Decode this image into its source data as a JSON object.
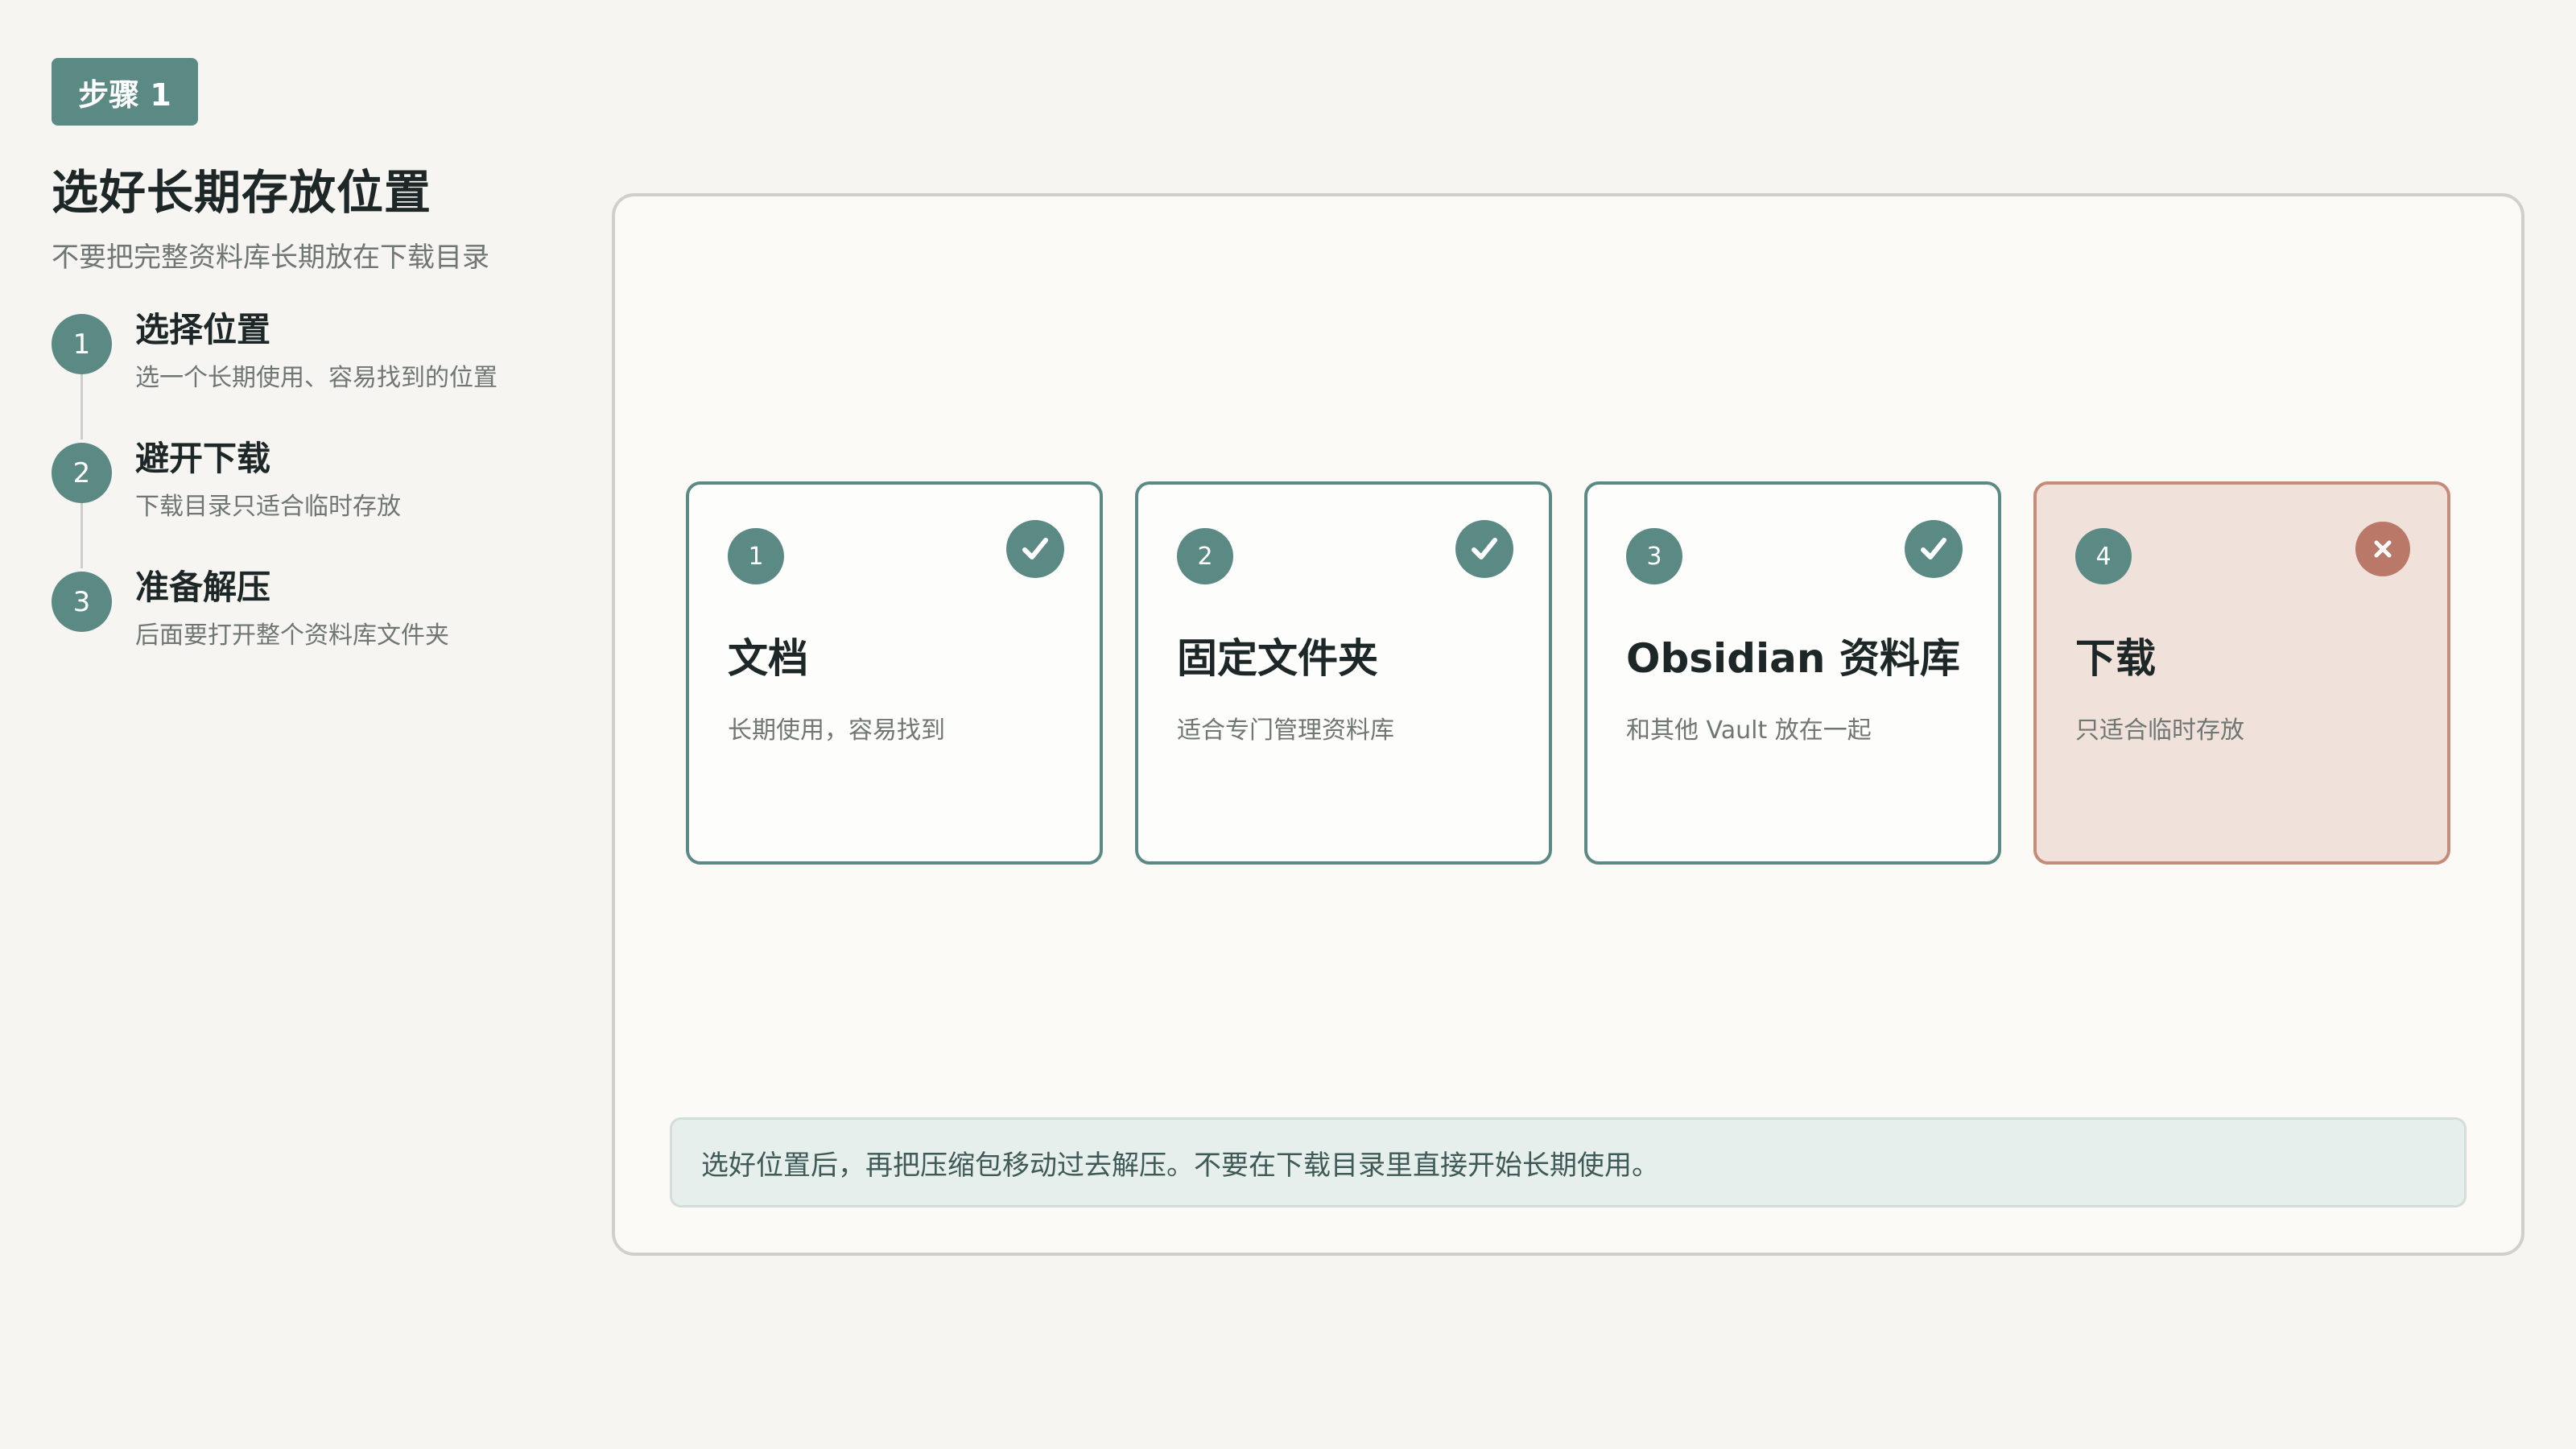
{
  "header": {
    "badge": "步骤 1",
    "title": "选好长期存放位置",
    "subtitle": "不要把完整资料库长期放在下载目录"
  },
  "steps": [
    {
      "number": "1",
      "title": "选择位置",
      "description": "选一个长期使用、容易找到的位置"
    },
    {
      "number": "2",
      "title": "避开下载",
      "description": "下载目录只适合临时存放"
    },
    {
      "number": "3",
      "title": "准备解压",
      "description": "后面要打开整个资料库文件夹"
    }
  ],
  "options": [
    {
      "number": "1",
      "title": "文档",
      "description": "长期使用，容易找到",
      "status": "check-icon"
    },
    {
      "number": "2",
      "title": "固定文件夹",
      "description": "适合专门管理资料库",
      "status": "check-icon"
    },
    {
      "number": "3",
      "title": "Obsidian 资料库",
      "description": "和其他 Vault 放在一起",
      "status": "check-icon"
    },
    {
      "number": "4",
      "title": "下载",
      "description": "只适合临时存放",
      "status": "x-icon"
    }
  ],
  "note": "选好位置后，再把压缩包移动过去解压。不要在下载目录里直接开始长期使用。",
  "colors": {
    "accent": "#5b8a85",
    "warning": "#b97868",
    "warning_bg": "#f0e2da",
    "note_bg": "#e6efec",
    "page_bg": "#f6f5f1"
  }
}
